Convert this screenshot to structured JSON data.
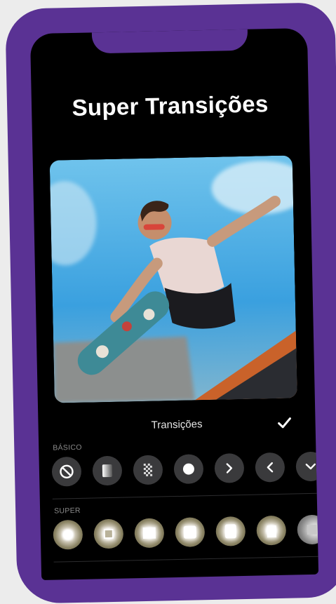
{
  "header": {
    "title": "Super Transições"
  },
  "photo": {
    "description_icon": "skateboarder-photo"
  },
  "panel": {
    "title": "Transições",
    "confirm_icon": "checkmark-icon"
  },
  "basic": {
    "label": "BÁSICO",
    "items": [
      "none-icon",
      "fade-gradient-icon",
      "dissolve-icon",
      "circle-icon",
      "slide-right-icon",
      "slide-left-icon",
      "slide-down-icon"
    ]
  },
  "super": {
    "label": "SUPER",
    "items": [
      "super-transition-1",
      "super-transition-2",
      "super-transition-3",
      "super-transition-4",
      "super-transition-5",
      "super-transition-6",
      "super-transition-7"
    ]
  },
  "colors": {
    "frame": "#5a3294",
    "screen": "#000000",
    "button": "#3a3a3c"
  }
}
